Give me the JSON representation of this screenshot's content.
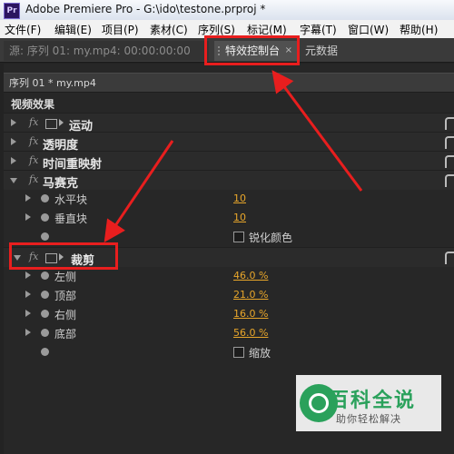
{
  "window": {
    "title": "Adobe Premiere Pro - G:\\ido\\testone.prproj *",
    "app_icon_label": "Pr"
  },
  "menu": [
    "文件(F)",
    "编辑(E)",
    "项目(P)",
    "素材(C)",
    "序列(S)",
    "标记(M)",
    "字幕(T)",
    "窗口(W)",
    "帮助(H)"
  ],
  "tabs": {
    "source": "源: 序列 01: my.mp4: 00:00:00:00",
    "effect_controls": "特效控制台",
    "metadata": "元数据",
    "close_symbol": "×"
  },
  "panel": {
    "sequence_label": "序列 01 * my.mp4",
    "section_video_effects": "视频效果",
    "fx_symbol": "fx"
  },
  "effects": {
    "motion": "运动",
    "opacity": "透明度",
    "time_remap": "时间重映射",
    "mosaic": {
      "name": "马赛克",
      "params": [
        {
          "name": "水平块",
          "value": "10"
        },
        {
          "name": "垂直块",
          "value": "10"
        }
      ],
      "checkbox_label": "锐化颜色"
    },
    "crop": {
      "name": "裁剪",
      "params": [
        {
          "name": "左侧",
          "value": "46.0 %"
        },
        {
          "name": "顶部",
          "value": "21.0 %"
        },
        {
          "name": "右侧",
          "value": "16.0 %"
        },
        {
          "name": "底部",
          "value": "56.0 %"
        }
      ],
      "checkbox_label": "缩放"
    }
  },
  "watermark": {
    "title": "百科全说",
    "subtitle": "助你轻松解决"
  },
  "colors": {
    "highlight": "#e81e1e",
    "value_orange": "#e8a62a",
    "watermark_green": "#2aa15b"
  }
}
